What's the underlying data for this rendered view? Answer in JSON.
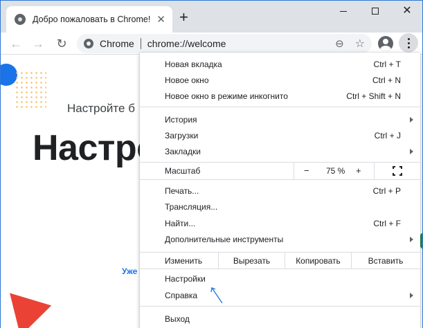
{
  "tab": {
    "title": "Добро пожаловать в Chrome!",
    "close": "✕"
  },
  "new_tab": "+",
  "window_controls": {
    "close": "✕"
  },
  "toolbar": {
    "back": "←",
    "forward": "→",
    "reload": "↻",
    "chip": "Chrome",
    "url": "chrome://welcome",
    "zoom_icon": "⊖",
    "star_icon": "☆"
  },
  "page": {
    "subtitle": "Настройте б",
    "headline": "Настро",
    "link_partial": "Уже"
  },
  "menu": {
    "new_tab": {
      "label": "Новая вкладка",
      "shortcut": "Ctrl + T"
    },
    "new_window": {
      "label": "Новое окно",
      "shortcut": "Ctrl + N"
    },
    "incognito": {
      "label": "Новое окно в режиме инкогнито",
      "shortcut": "Ctrl + Shift + N"
    },
    "history": {
      "label": "История"
    },
    "downloads": {
      "label": "Загрузки",
      "shortcut": "Ctrl + J"
    },
    "bookmarks": {
      "label": "Закладки"
    },
    "zoom": {
      "label": "Масштаб",
      "minus": "−",
      "value": "75 %",
      "plus": "+"
    },
    "print": {
      "label": "Печать...",
      "shortcut": "Ctrl + P"
    },
    "cast": {
      "label": "Трансляция..."
    },
    "find": {
      "label": "Найти...",
      "shortcut": "Ctrl + F"
    },
    "more_tools": {
      "label": "Дополнительные инструменты"
    },
    "edit": {
      "label": "Изменить",
      "cut": "Вырезать",
      "copy": "Копировать",
      "paste": "Вставить"
    },
    "settings": {
      "label": "Настройки"
    },
    "help": {
      "label": "Справка"
    },
    "exit": {
      "label": "Выход"
    }
  },
  "colors": {
    "accent": "#1a73e8",
    "tabstrip": "#dee1e6",
    "pointer": "#2b7bd6"
  }
}
